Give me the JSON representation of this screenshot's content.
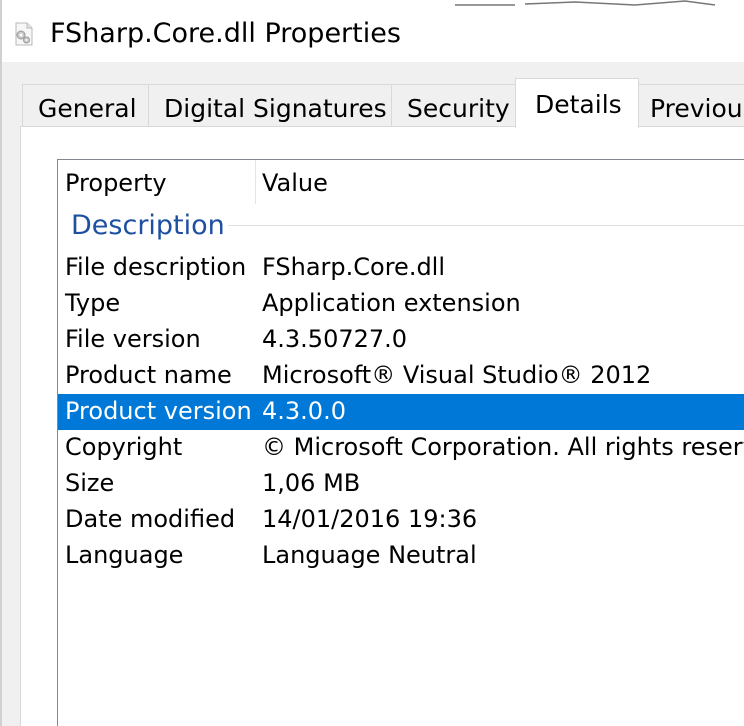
{
  "window": {
    "title": "FSharp.Core.dll Properties",
    "icon": "dll-file-gear-icon"
  },
  "tabs": [
    {
      "label": "General",
      "active": false
    },
    {
      "label": "Digital Signatures",
      "active": false
    },
    {
      "label": "Security",
      "active": false
    },
    {
      "label": "Details",
      "active": true
    },
    {
      "label": "Previous",
      "active": false
    }
  ],
  "details": {
    "columns": {
      "property": "Property",
      "value": "Value"
    },
    "group_label": "Description",
    "rows": [
      {
        "property": "File description",
        "value": "FSharp.Core.dll",
        "selected": false
      },
      {
        "property": "Type",
        "value": "Application extension",
        "selected": false
      },
      {
        "property": "File version",
        "value": "4.3.50727.0",
        "selected": false
      },
      {
        "property": "Product name",
        "value": "Microsoft® Visual Studio® 2012",
        "selected": false
      },
      {
        "property": "Product version",
        "value": "4.3.0.0",
        "selected": true
      },
      {
        "property": "Copyright",
        "value": "© Microsoft Corporation. All rights reserv",
        "selected": false
      },
      {
        "property": "Size",
        "value": "1,06 MB",
        "selected": false
      },
      {
        "property": "Date modified",
        "value": "14/01/2016 19:36",
        "selected": false
      },
      {
        "property": "Language",
        "value": "Language Neutral",
        "selected": false
      }
    ]
  },
  "colors": {
    "selection": "#0078d7",
    "group_label": "#1e50a2",
    "dialog_background": "#f0f0f0"
  }
}
